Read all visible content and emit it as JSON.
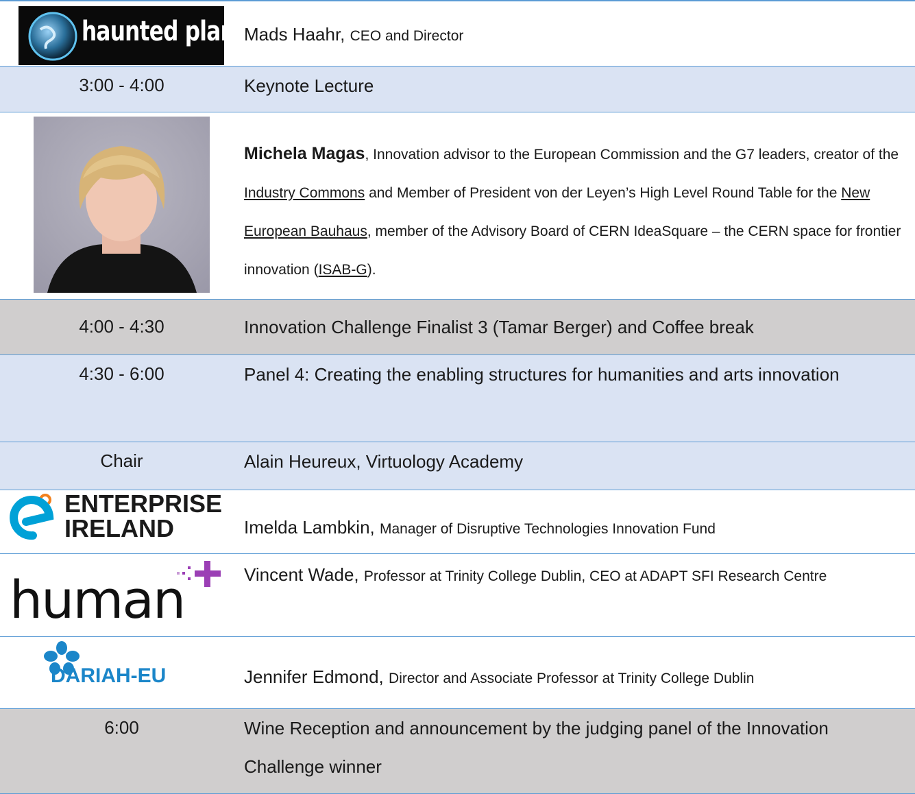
{
  "rows": {
    "haunted": {
      "logo_text": "haunted planet",
      "name": "Mads Haahr,",
      "role": "CEO and Director"
    },
    "keynote": {
      "time": "3:00 - 4:00",
      "title": "Keynote Lecture"
    },
    "magas": {
      "name": "Michela Magas",
      "t1": ", Innovation advisor to the European Commission and the G7 leaders, creator of the ",
      "link1": "Industry Commons",
      "t2": " and Member of President von der Leyen’s High Level Round Table for the ",
      "link2": "New European Bauhaus",
      "t3": ", member of the Advisory Board of CERN IdeaSquare – the CERN space for frontier innovation (",
      "link3": "ISAB-G",
      "t4": ")."
    },
    "coffee": {
      "time": "4:00 - 4:30",
      "title": "Innovation Challenge Finalist 3 (Tamar Berger) and Coffee break"
    },
    "panel4": {
      "time": "4:30 - 6:00",
      "title": "Panel 4: Creating the enabling structures for humanities and arts innovation"
    },
    "chair": {
      "time": "Chair",
      "title": "Alain Heureux, Virtuology Academy"
    },
    "enterprise": {
      "logo_line1": "ENTERPRISE",
      "logo_line2": "IRELAND",
      "name": "Imelda Lambkin,",
      "role": "Manager of Disruptive Technologies Innovation Fund"
    },
    "human": {
      "logo_text": "human",
      "name": "Vincent Wade,",
      "role": "Professor at Trinity College Dublin, CEO at ADAPT SFI Research Centre"
    },
    "dariah": {
      "logo_text": "DARIAH-EU",
      "name": "Jennifer Edmond,",
      "role": "Director and Associate Professor at Trinity College Dublin"
    },
    "wine": {
      "time": "6:00",
      "title": "Wine Reception and announcement by the judging panel of the Innovation Challenge winner"
    }
  }
}
